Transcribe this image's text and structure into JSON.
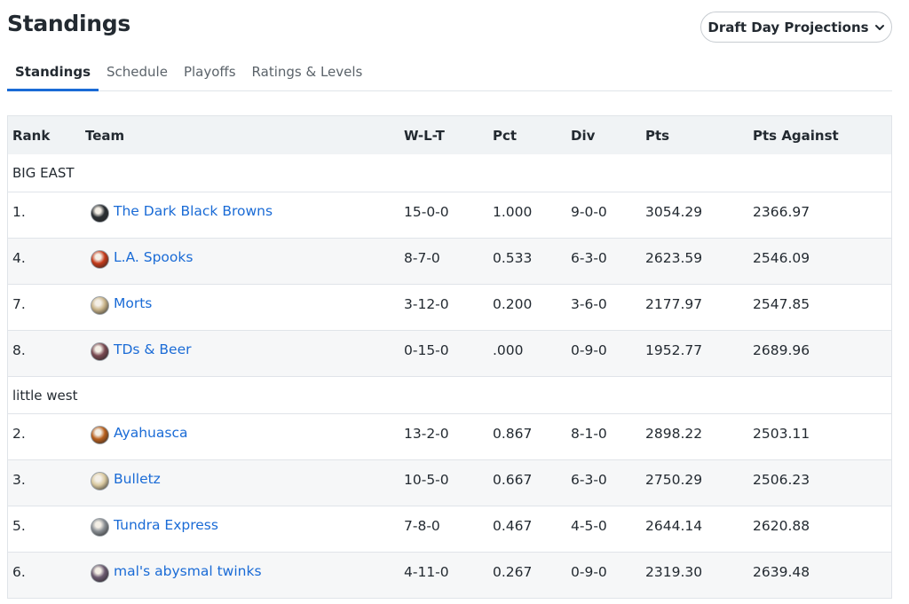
{
  "page": {
    "title": "Standings"
  },
  "projection_button": {
    "label": "Draft Day Projections",
    "icon": "chevron-down-icon"
  },
  "tabs": [
    {
      "label": "Standings",
      "active": true
    },
    {
      "label": "Schedule",
      "active": false
    },
    {
      "label": "Playoffs",
      "active": false
    },
    {
      "label": "Ratings & Levels",
      "active": false
    }
  ],
  "table": {
    "headers": {
      "rank": "Rank",
      "team": "Team",
      "wlt": "W-L-T",
      "pct": "Pct",
      "div": "Div",
      "pts": "Pts",
      "pts_against": "Pts Against"
    },
    "groups": [
      {
        "name": "BIG EAST",
        "rows": [
          {
            "rank": "1.",
            "team": "The Dark Black Browns",
            "wlt": "15-0-0",
            "pct": "1.000",
            "div": "9-0-0",
            "pts": "3054.29",
            "pts_against": "2366.97",
            "avatar_color": "#2b2f33"
          },
          {
            "rank": "4.",
            "team": "L.A. Spooks",
            "wlt": "8-7-0",
            "pct": "0.533",
            "div": "6-3-0",
            "pts": "2623.59",
            "pts_against": "2546.09",
            "avatar_color": "#c43a1a"
          },
          {
            "rank": "7.",
            "team": "Morts",
            "wlt": "3-12-0",
            "pct": "0.200",
            "div": "3-6-0",
            "pts": "2177.97",
            "pts_against": "2547.85",
            "avatar_color": "#c9b48a"
          },
          {
            "rank": "8.",
            "team": "TDs & Beer",
            "wlt": "0-15-0",
            "pct": ".000",
            "div": "0-9-0",
            "pts": "1952.77",
            "pts_against": "2689.96",
            "avatar_color": "#7a4a52"
          }
        ]
      },
      {
        "name": "little west",
        "rows": [
          {
            "rank": "2.",
            "team": "Ayahuasca",
            "wlt": "13-2-0",
            "pct": "0.867",
            "div": "8-1-0",
            "pts": "2898.22",
            "pts_against": "2503.11",
            "avatar_color": "#b8601e"
          },
          {
            "rank": "3.",
            "team": "Bulletz",
            "wlt": "10-5-0",
            "pct": "0.667",
            "div": "6-3-0",
            "pts": "2750.29",
            "pts_against": "2506.23",
            "avatar_color": "#d9c9a0"
          },
          {
            "rank": "5.",
            "team": "Tundra Express",
            "wlt": "7-8-0",
            "pct": "0.467",
            "div": "4-5-0",
            "pts": "2644.14",
            "pts_against": "2620.88",
            "avatar_color": "#8a8f94"
          },
          {
            "rank": "6.",
            "team": "mal's abysmal twinks",
            "wlt": "4-11-0",
            "pct": "0.267",
            "div": "0-9-0",
            "pts": "2319.30",
            "pts_against": "2639.48",
            "avatar_color": "#6b5a70"
          }
        ]
      }
    ]
  },
  "colors": {
    "link": "#1a6bd6",
    "tab_underline": "#1a6bd6",
    "header_bg": "#f0f3f5",
    "row_shade": "#f6f7f8"
  }
}
